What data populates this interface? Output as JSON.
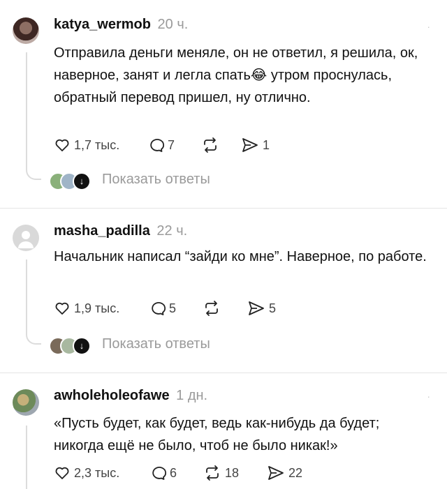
{
  "posts": [
    {
      "username": "katya_wermob",
      "time": "20 ч.",
      "text": "Отправила деньги меняле, он не ответил, я решила, ок, наверное,  занят и легла спать😂 утром проснулась, обратный перевод пришел, ну отлично.",
      "likes": "1,7 тыс.",
      "comments": "7",
      "reposts": "",
      "shares": "1",
      "show_replies": "Показать ответы"
    },
    {
      "username": "masha_padilla",
      "time": "22 ч.",
      "text": "Начальник написал “зайди ко мне”. Наверное, по работе.",
      "likes": "1,9 тыс.",
      "comments": "5",
      "reposts": "",
      "shares": "5",
      "show_replies": "Показать ответы"
    },
    {
      "username": "awholeholeofawe",
      "time": "1 дн.",
      "text": "«Пусть будет, как будет, ведь как-нибудь да будет; никогда ещё не было, чтоб не было никак!»",
      "likes": "2,3 тыс.",
      "comments": "6",
      "reposts": "18",
      "shares": "22"
    }
  ],
  "icons": {
    "more": "more-icon",
    "like": "heart-icon",
    "comment": "comment-icon",
    "repost": "repost-icon",
    "share": "share-icon",
    "expand": "chevron-down-icon"
  }
}
